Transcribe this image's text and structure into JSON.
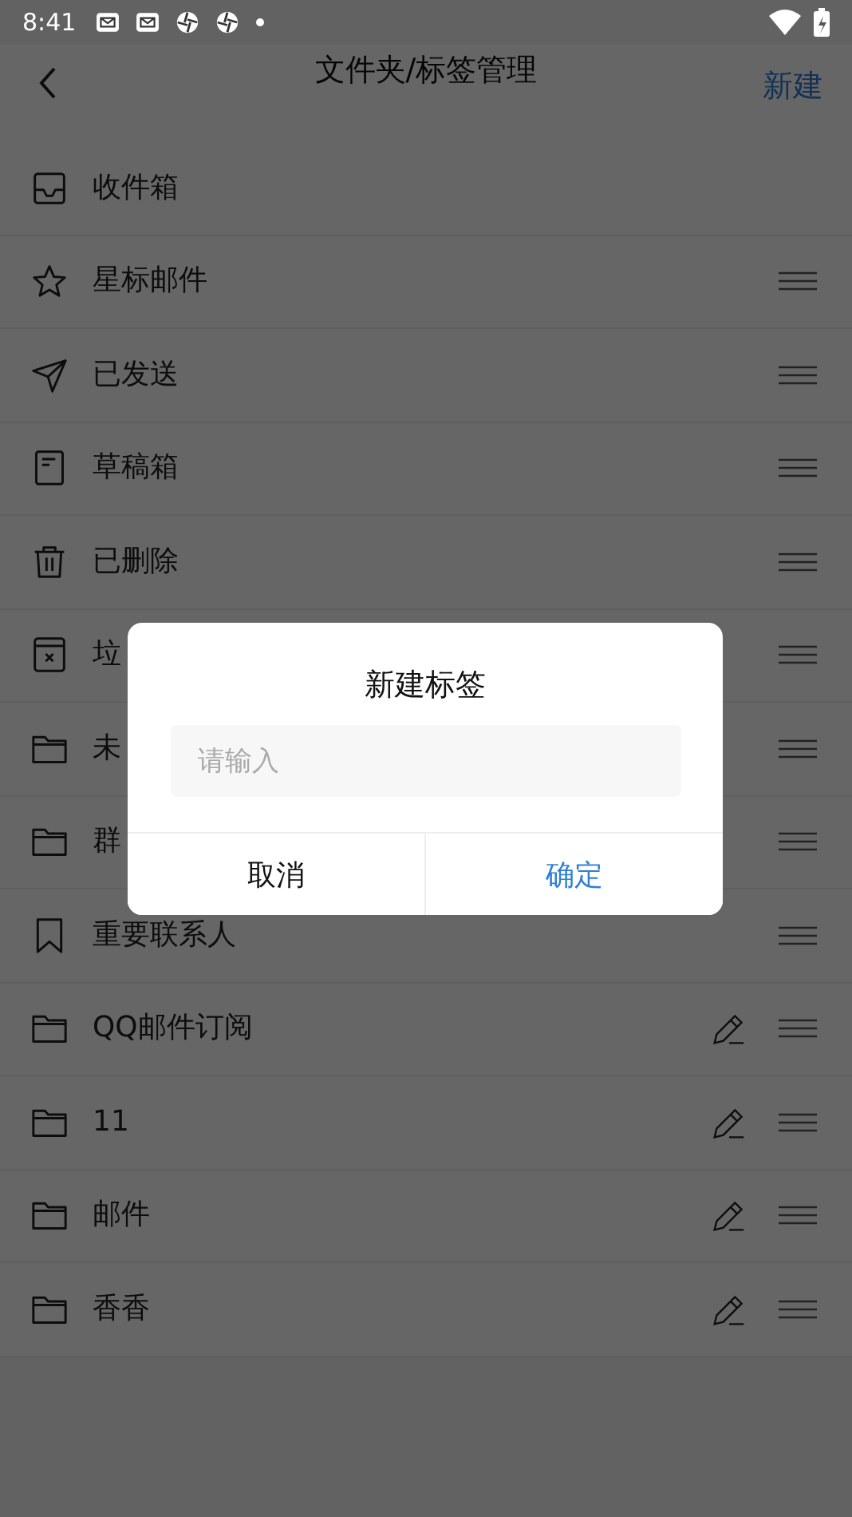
{
  "status_bar": {
    "time": "8:41"
  },
  "header": {
    "title": "文件夹/标签管理",
    "action": "新建"
  },
  "folders": [
    {
      "name": "收件箱",
      "kind": "inbox",
      "draggable": false,
      "editable": false
    },
    {
      "name": "星标邮件",
      "kind": "star",
      "draggable": true,
      "editable": false
    },
    {
      "name": "已发送",
      "kind": "sent",
      "draggable": true,
      "editable": false
    },
    {
      "name": "草稿箱",
      "kind": "drafts",
      "draggable": true,
      "editable": false
    },
    {
      "name": "已删除",
      "kind": "deleted",
      "draggable": true,
      "editable": false
    },
    {
      "name": "垃",
      "kind": "spam",
      "draggable": true,
      "editable": false
    },
    {
      "name": "未",
      "kind": "folder",
      "draggable": true,
      "editable": false
    },
    {
      "name": "群",
      "kind": "folder",
      "draggable": true,
      "editable": false
    },
    {
      "name": "重要联系人",
      "kind": "contacts",
      "draggable": true,
      "editable": false
    },
    {
      "name": "QQ邮件订阅",
      "kind": "folder",
      "draggable": true,
      "editable": true
    },
    {
      "name": "11",
      "kind": "folder",
      "draggable": true,
      "editable": true
    },
    {
      "name": "邮件",
      "kind": "folder",
      "draggable": true,
      "editable": true
    },
    {
      "name": "香香",
      "kind": "folder",
      "draggable": true,
      "editable": true
    }
  ],
  "dialog": {
    "title": "新建标签",
    "input": {
      "placeholder": "请输入"
    },
    "buttons": [
      {
        "label": "取消",
        "kind": "cancel"
      },
      {
        "label": "确定",
        "kind": "confirm"
      }
    ]
  }
}
